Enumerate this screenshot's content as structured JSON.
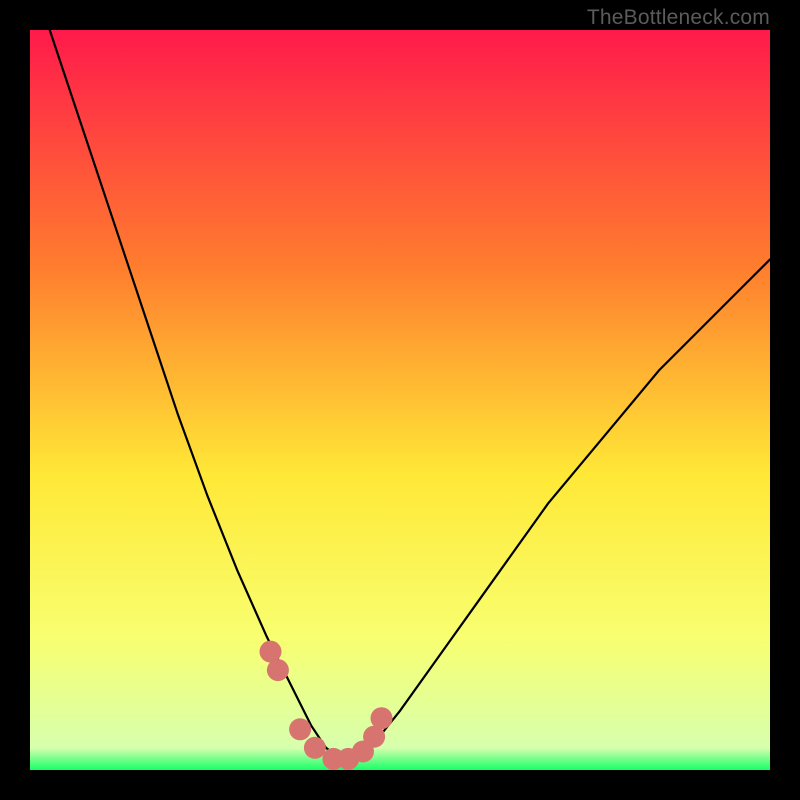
{
  "watermark": "TheBottleneck.com",
  "colors": {
    "frame": "#000000",
    "grad_top": "#ff1a4b",
    "grad_mid1": "#ff7d2e",
    "grad_mid2": "#ffe836",
    "grad_mid3": "#f8ff70",
    "grad_bottom": "#17ff68",
    "curve_stroke": "#000000",
    "marker_fill": "#d7746f",
    "marker_stroke": "#b6403e"
  },
  "chart_data": {
    "type": "line",
    "title": "",
    "xlabel": "",
    "ylabel": "",
    "xlim": [
      0,
      100
    ],
    "ylim": [
      0,
      100
    ],
    "series": [
      {
        "name": "bottleneck-curve",
        "x": [
          0,
          4,
          8,
          12,
          16,
          20,
          24,
          28,
          32,
          34,
          36,
          38,
          40,
          42,
          44,
          46,
          50,
          55,
          60,
          65,
          70,
          75,
          80,
          85,
          90,
          95,
          100
        ],
        "y": [
          108,
          96,
          84,
          72,
          60,
          48,
          37,
          27,
          18,
          14,
          10,
          6,
          3,
          1.5,
          1.5,
          3,
          8,
          15,
          22,
          29,
          36,
          42,
          48,
          54,
          59,
          64,
          69
        ]
      }
    ],
    "markers": {
      "name": "highlight-region",
      "x": [
        32.5,
        33.5,
        36.5,
        38.5,
        41.0,
        43.0,
        45.0,
        46.5,
        47.5
      ],
      "y": [
        16,
        13.5,
        5.5,
        3,
        1.5,
        1.5,
        2.5,
        4.5,
        7
      ]
    }
  }
}
